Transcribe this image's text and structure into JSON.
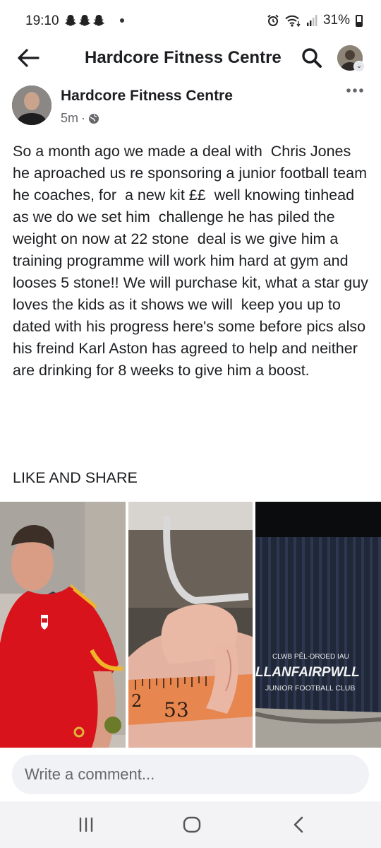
{
  "status_bar": {
    "time": "19:10",
    "battery": "31%",
    "icons": [
      "snapchat-icon",
      "snapchat-icon",
      "snapchat-icon",
      "dot-icon",
      "alarm-icon",
      "wifi-icon",
      "signal-icon",
      "battery-icon"
    ]
  },
  "header": {
    "title": "Hardcore Fitness Centre",
    "back_icon": "back-arrow-icon",
    "search_icon": "search-icon"
  },
  "post": {
    "author": "Hardcore Fitness Centre",
    "time": "5m",
    "separator": "·",
    "privacy_icon": "globe-icon",
    "body": "So a month ago we made a deal with  Chris Jones  he aproached us re sponsoring a junior football team he coaches, for  a new kit ££  well knowing tinhead as we do we set him  challenge he has piled the weight on now at 22 stone  deal is we give him a training programme will work him hard at gym and looses 5 stone!! We will purchase kit, what a star guy loves the kids as it shows we will  keep you up to dated with his progress here's some before pics also  his freind Karl Aston has agreed to help and neither are drinking for 8 weeks to give him a boost.",
    "cta": "LIKE AND SHARE",
    "photos": [
      {
        "name": "photo-man-red-shirt"
      },
      {
        "name": "photo-tape-measure",
        "tape_text": "53",
        "tape_text_2": "2"
      },
      {
        "name": "photo-beanie",
        "line1": "CLWB PÊL-DROED IAU",
        "line2": "LLANFAIRPWLL",
        "line3": "JUNIOR FOOTBALL CLUB"
      }
    ]
  },
  "comment": {
    "placeholder": "Write a comment..."
  },
  "nav": {
    "recent_icon": "recent-apps-icon",
    "home_icon": "home-icon",
    "back_icon": "nav-back-icon"
  },
  "colors": {
    "text": "#1c1e21",
    "secondary": "#65676b",
    "input_bg": "#f0f2f5",
    "wales_red": "#d8131b"
  }
}
